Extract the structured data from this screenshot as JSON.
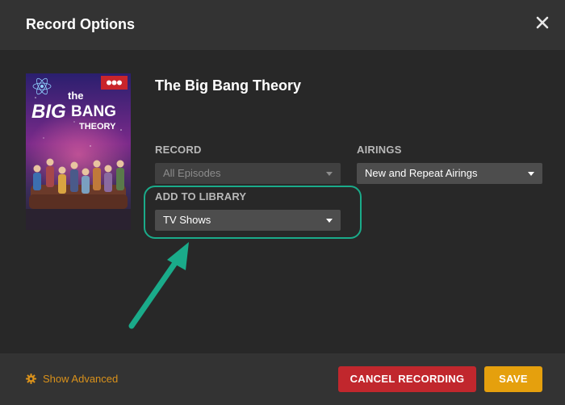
{
  "dialog": {
    "title": "Record Options"
  },
  "show": {
    "title": "The Big Bang Theory",
    "poster_logo": [
      "the",
      "BIG",
      "BANG",
      "THEORY"
    ]
  },
  "record": {
    "label": "RECORD",
    "value": "All Episodes"
  },
  "airings": {
    "label": "AIRINGS",
    "value": "New and Repeat Airings"
  },
  "library": {
    "label": "ADD TO LIBRARY",
    "value": "TV Shows"
  },
  "footer": {
    "advanced_label": "Show Advanced",
    "cancel_label": "CANCEL RECORDING",
    "save_label": "SAVE"
  },
  "colors": {
    "accent": "#e5a00d",
    "cancel": "#c1272d",
    "highlight": "#1aab8a"
  }
}
